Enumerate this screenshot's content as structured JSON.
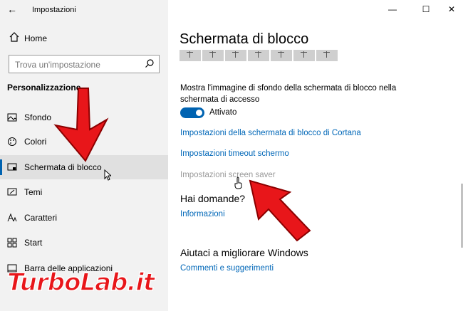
{
  "window": {
    "app_title": "Impostazioni"
  },
  "sidebar": {
    "home_label": "Home",
    "search_placeholder": "Trova un'impostazione",
    "section_title": "Personalizzazione",
    "items": [
      {
        "label": "Sfondo",
        "icon": "picture-icon"
      },
      {
        "label": "Colori",
        "icon": "palette-icon"
      },
      {
        "label": "Schermata di blocco",
        "icon": "lock-screen-icon",
        "selected": true
      },
      {
        "label": "Temi",
        "icon": "brush-icon"
      },
      {
        "label": "Caratteri",
        "icon": "font-icon"
      },
      {
        "label": "Start",
        "icon": "start-icon"
      },
      {
        "label": "Barra delle applicazioni",
        "icon": "taskbar-icon"
      }
    ]
  },
  "main": {
    "title": "Schermata di blocco",
    "tiles_count": 7,
    "signin_background_desc": "Mostra l'immagine di sfondo della schermata di blocco nella schermata di accesso",
    "toggle_state": "Attivato",
    "links": {
      "cortana": "Impostazioni della schermata di blocco di Cortana",
      "timeout": "Impostazioni timeout schermo",
      "screensaver": "Impostazioni screen saver"
    },
    "questions_title": "Hai domande?",
    "info_link": "Informazioni",
    "improve_title": "Aiutaci a migliorare Windows",
    "feedback_link": "Commenti e suggerimenti"
  },
  "watermark": "TurboLab.it",
  "colors": {
    "accent": "#0063b1",
    "link": "#0067b8",
    "arrow": "#e8161a"
  }
}
